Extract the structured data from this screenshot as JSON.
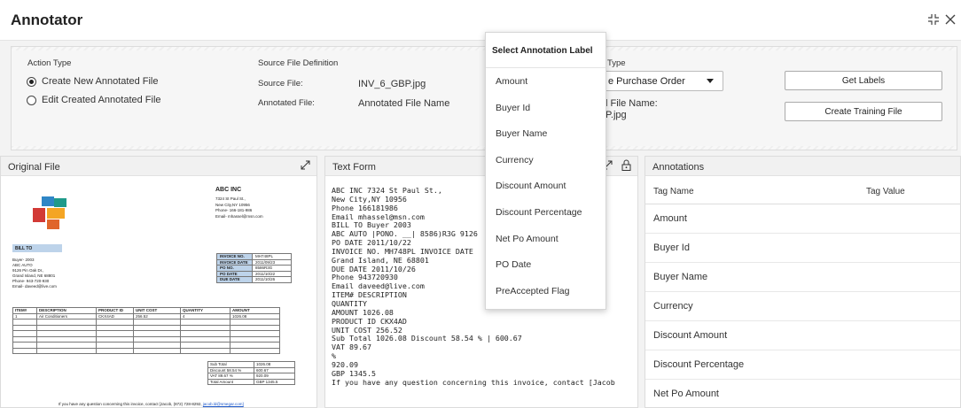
{
  "app": {
    "title": "Annotator"
  },
  "config": {
    "action_type_label": "Action Type",
    "actions": [
      "Create New Annotated File",
      "Edit Created Annotated File"
    ],
    "selected_action": 0,
    "source_def_label": "Source File Definition",
    "source_file_label": "Source File:",
    "source_file_value": "INV_6_GBP.jpg",
    "annotated_file_label": "Annotated File:",
    "annotated_file_value": "Annotated File Name",
    "type_label_visible": "Type",
    "type_select_visible": "e Purchase Order",
    "file_name_label_visible": "l File Name:",
    "file_name_value_visible": "P.jpg",
    "get_labels_button": "Get Labels",
    "create_training_button": "Create Training File"
  },
  "panels": {
    "original_file_title": "Original File",
    "text_form_title": "Text Form",
    "annotations_title": "Annotations"
  },
  "invoice": {
    "company": "ABC INC",
    "address_lines": [
      "7324 St Paul St.,",
      "New City,NY 10956",
      "Phone- 166-181-986",
      "Email- mhassel@msn.com"
    ],
    "bill_to_label": "BILL TO",
    "bill_to_lines": [
      "Buyer- 2003",
      "ABC AUTO",
      "9126 Pin Oak Dr.,",
      "Grand Island, NE 68801",
      "Phone- 943-720-930",
      "Email- daveed@live.com"
    ],
    "meta": [
      {
        "k": "INVOICE NO.",
        "v": "MH748PL"
      },
      {
        "k": "INVOICE DATE",
        "v": "2011/09/23"
      },
      {
        "k": "PO NO.",
        "v": "8586R3G"
      },
      {
        "k": "PO DATE",
        "v": "2011/10/22"
      },
      {
        "k": "DUE DATE",
        "v": "2011/10/26"
      }
    ],
    "item_headers": [
      "ITEM#",
      "DESCRIPTION",
      "PRODUCT ID",
      "UNIT COST",
      "QUANTITY",
      "AMOUNT"
    ],
    "item_row": [
      "1",
      "Air Conditioners",
      "CKX4AD",
      "256.52",
      "4",
      "1026.08"
    ],
    "totals": [
      {
        "k": "Sub Total",
        "v": "1026.08"
      },
      {
        "k": "Discount  58.54  %",
        "v": "600.67"
      },
      {
        "k": "VAT  89.67    %",
        "v": "920.09"
      },
      {
        "k": "Total Amount",
        "v": "GBP   1345.5"
      }
    ],
    "footer_text": "If you have any question concerning this invoice, contact [Jacob, (872) 728-8292, ",
    "footer_link": "jacob.ld@smegar.com]"
  },
  "text_form_lines": [
    "ABC INC 7324 St Paul St.,",
    "New City,NY 10956",
    "Phone 166181986",
    "Email mhassel@msn.com",
    "BILL TO Buyer 2003",
    "ABC AUTO |PONO. __| 8586)R3G 9126",
    "PO DATE 2011/10/22",
    "INVOICE NO. MH748PL INVOICE DATE",
    "Grand Island, NE 68801",
    "DUE DATE 2011/10/26",
    "Phone 943720930",
    "Email daveed@live.com",
    "ITEM# DESCRIPTION",
    "QUANTITY",
    "AMOUNT 1026.08",
    "PRODUCT ID CKX4AD",
    "UNIT COST 256.52",
    "Sub Total 1026.08 Discount 58.54 % | 600.67",
    "VAT 89.67",
    "%",
    "920.09",
    "GBP 1345.5",
    "If you have any question concerning this invoice, contact [Jacob"
  ],
  "annotations": {
    "col_tag_name": "Tag Name",
    "col_tag_value": "Tag Value",
    "rows": [
      "Amount",
      "Buyer Id",
      "Buyer Name",
      "Currency",
      "Discount Amount",
      "Discount Percentage",
      "Net Po Amount"
    ]
  },
  "dropdown": {
    "title": "Select Annotation Label",
    "items": [
      "Amount",
      "Buyer Id",
      "Buyer Name",
      "Currency",
      "Discount Amount",
      "Discount Percentage",
      "Net Po Amount",
      "PO Date",
      "PreAccepted Flag"
    ]
  },
  "icons": {
    "window_collapse": "collapse-icon",
    "window_close": "close-icon",
    "expand": "expand-diagonal-icon",
    "lock": "lock-icon"
  },
  "colors": {
    "invoice_header_fill": "#bdd3ea",
    "link": "#1a56c9"
  }
}
